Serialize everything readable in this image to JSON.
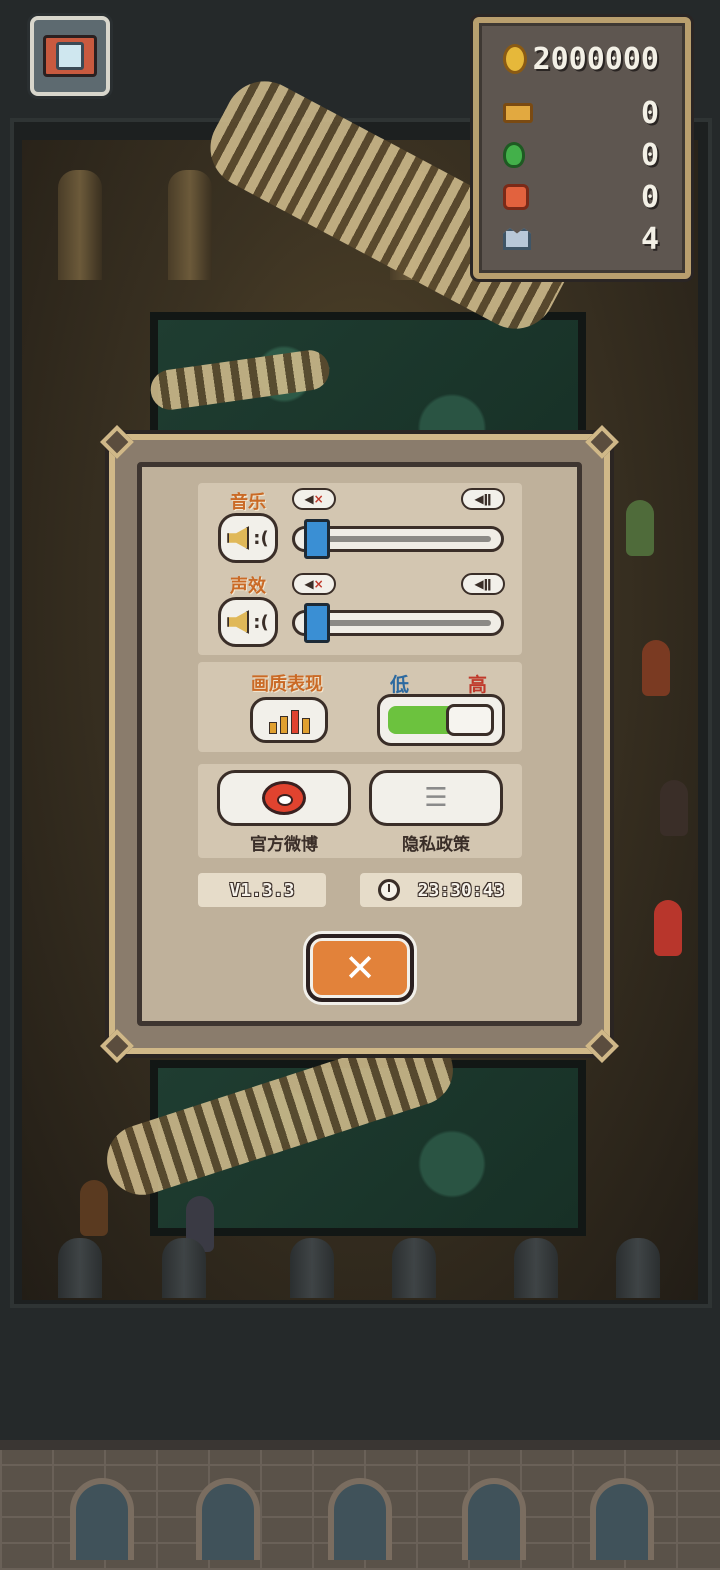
{
  "resources": {
    "coins": "2000000",
    "tickets": "0",
    "potions": "0",
    "bags": "0",
    "crowns": "4"
  },
  "settings": {
    "music_label": "音乐",
    "sound_label": "声效",
    "music_level": 0.05,
    "sound_level": 0.05,
    "quality_label": "画质表现",
    "quality_low": "低",
    "quality_high": "高",
    "quality_value": "低",
    "weibo_label": "官方微博",
    "privacy_label": "隐私政策",
    "version": "V1.3.3",
    "time": "23:30:43"
  },
  "colors": {
    "accent_orange": "#e2823a",
    "slider_blue": "#3a8fd4",
    "toggle_green": "#6cc23e"
  },
  "icons": [
    "camera-icon",
    "coin-icon",
    "ticket-icon",
    "potion-icon",
    "bag-icon",
    "crown-icon",
    "speaker-icon",
    "mute-icon",
    "volume-icon",
    "quality-chart-icon",
    "weibo-icon",
    "list-icon",
    "clock-icon",
    "close-icon"
  ]
}
